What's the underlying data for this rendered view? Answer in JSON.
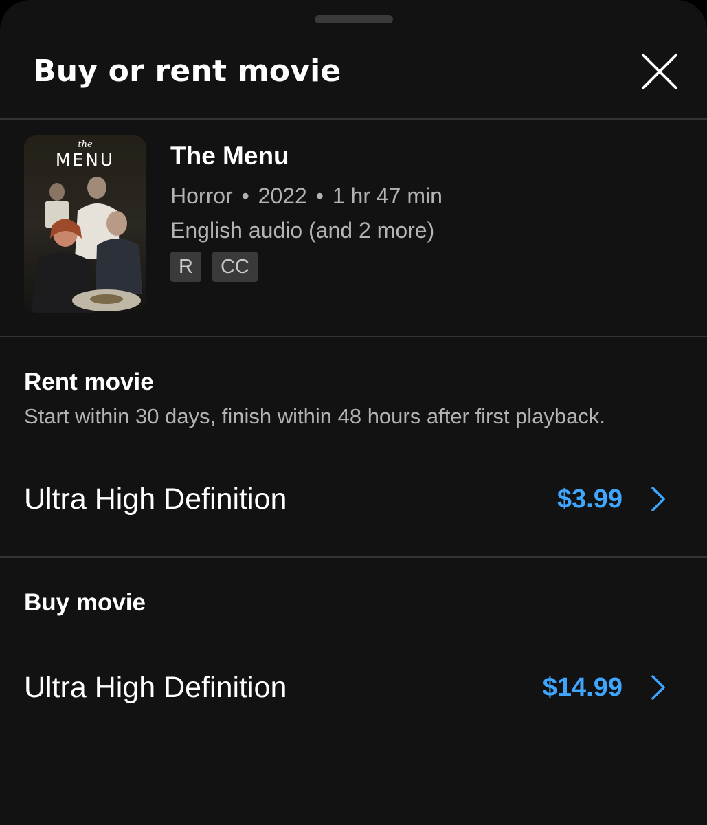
{
  "sheet": {
    "title": "Buy or rent movie"
  },
  "movie": {
    "title": "The Menu",
    "genre": "Horror",
    "year": "2022",
    "duration": "1 hr 47 min",
    "separator": "•",
    "audio": "English audio (and 2 more)",
    "rating_badge": "R",
    "cc_badge": "CC",
    "poster": {
      "title_small": "the",
      "title_big": "MENU"
    }
  },
  "rent": {
    "title": "Rent movie",
    "description": "Start within 30 days, finish within 48 hours after first playback.",
    "options": [
      {
        "label": "Ultra High Definition",
        "price": "$3.99"
      }
    ]
  },
  "buy": {
    "title": "Buy movie",
    "options": [
      {
        "label": "Ultra High Definition",
        "price": "$14.99"
      }
    ]
  },
  "colors": {
    "background": "#121212",
    "price_accent": "#3ea6ff",
    "secondary_text": "#b3b3b3",
    "badge_bg": "#3a3a3a",
    "divider": "#333333"
  },
  "icons": {
    "close": "close-icon",
    "chevron": "chevron-right-icon"
  }
}
